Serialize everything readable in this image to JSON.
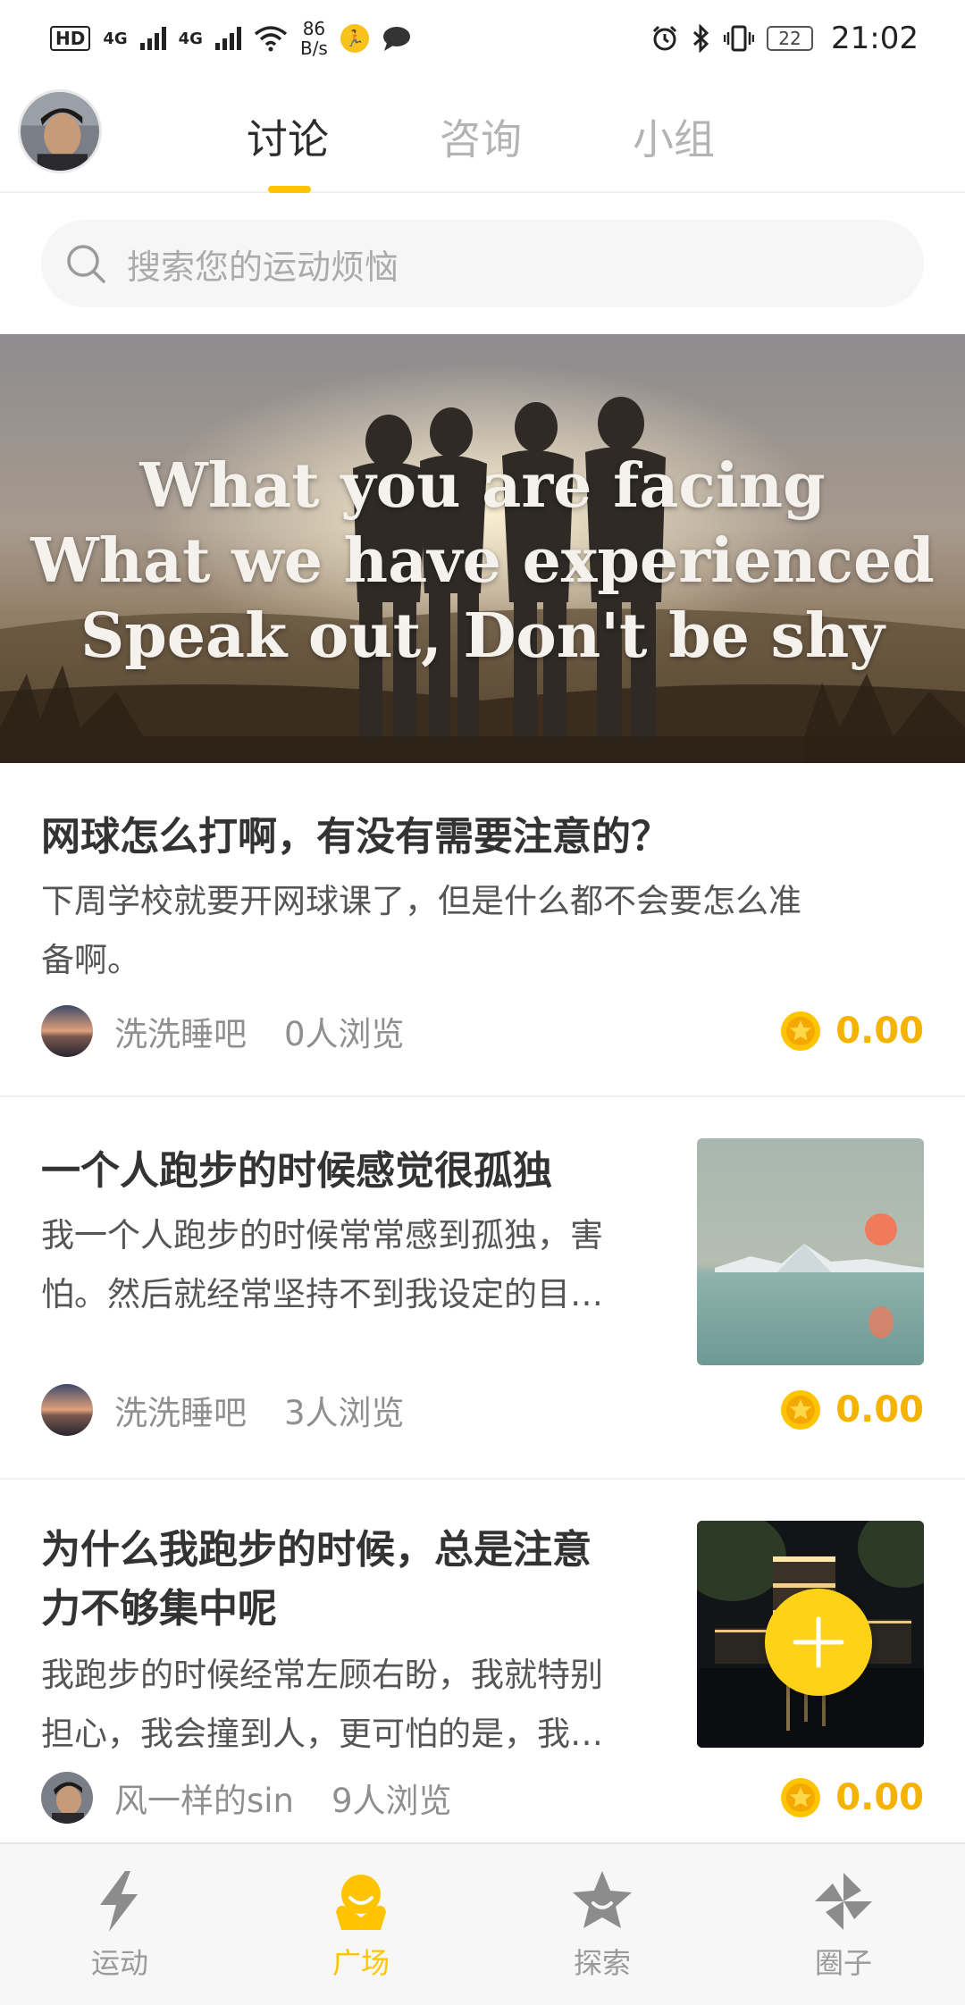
{
  "status_bar": {
    "hd": "HD",
    "sig1": "4G",
    "sig2": "4G",
    "speed_value": "86",
    "speed_unit": "B/s",
    "battery": "22",
    "time": "21:02"
  },
  "top_nav": {
    "tabs": [
      {
        "label": "讨论",
        "active": true
      },
      {
        "label": "咨询",
        "active": false
      },
      {
        "label": "小组",
        "active": false
      }
    ]
  },
  "search": {
    "placeholder": "搜索您的运动烦恼"
  },
  "banner": {
    "line1": "What you are facing",
    "line2": "What we have experienced",
    "line3": "Speak out, Don't be shy"
  },
  "posts": [
    {
      "title": "网球怎么打啊，有没有需要注意的？",
      "body_line1": "下周学校就要开网球课了，但是什么都不会要怎么准",
      "body_line2": "备啊。",
      "author": "洗洗睡吧",
      "views": "0人浏览",
      "coins": "0.00"
    },
    {
      "title": "一个人跑步的时候感觉很孤独",
      "body_line1": "我一个人跑步的时候常常感到孤独，害",
      "body_line2": "怕。然后就经常坚持不到我设定的目…",
      "author": "洗洗睡吧",
      "views": "3人浏览",
      "coins": "0.00"
    },
    {
      "title_line1": "为什么我跑步的时候，总是注意",
      "title_line2": "力不够集中呢",
      "body_line1": "我跑步的时候经常左顾右盼，我就特别",
      "body_line2": "担心，我会撞到人，更可怕的是，我…",
      "author": "风一样的sin",
      "views": "9人浏览",
      "coins": "0.00"
    }
  ],
  "bottom_nav": {
    "items": [
      {
        "label": "运动",
        "icon": "lightning-icon",
        "active": false
      },
      {
        "label": "广场",
        "icon": "square-mascot-icon",
        "active": true
      },
      {
        "label": "探索",
        "icon": "star-badge-icon",
        "active": false
      },
      {
        "label": "圈子",
        "icon": "pinwheel-icon",
        "active": false
      }
    ]
  },
  "colors": {
    "accent": "#ffc400",
    "coin": "#f5b300",
    "inactive": "#9a9a9a"
  }
}
